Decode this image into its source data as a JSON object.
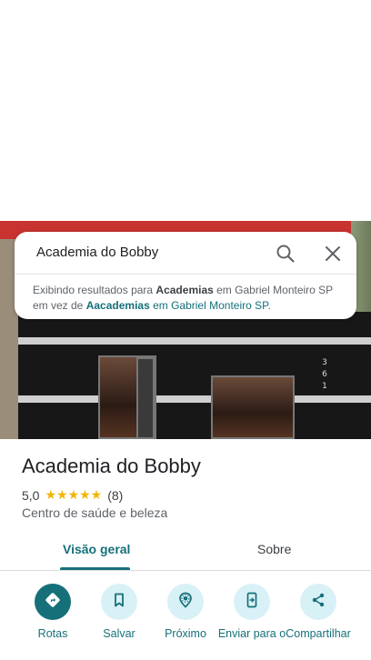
{
  "search": {
    "query": "Academia do Bobby",
    "notice_prefix": "Exibindo resultados para ",
    "notice_term": "Academias",
    "notice_middle": " em Gabriel Monteiro SP em vez de ",
    "notice_original_term": "Aacademias",
    "notice_original_rest": " em Gabriel Monteiro SP",
    "notice_suffix": "."
  },
  "photo": {
    "address_digits": "3\n6\n1"
  },
  "place": {
    "title": "Academia do Bobby",
    "rating": "5,0",
    "stars": "★★★★★",
    "review_count": "(8)",
    "category": "Centro de saúde e beleza"
  },
  "tabs": [
    {
      "label": "Visão geral",
      "selected": true
    },
    {
      "label": "Sobre",
      "selected": false
    }
  ],
  "actions": [
    {
      "label": "Rotas",
      "icon": "directions-icon"
    },
    {
      "label": "Salvar",
      "icon": "bookmark-icon"
    },
    {
      "label": "Próximo",
      "icon": "nearby-icon"
    },
    {
      "label": "Enviar para o",
      "icon": "send-to-phone-icon"
    },
    {
      "label": "Compartilhar",
      "icon": "share-icon"
    }
  ],
  "colors": {
    "accent": "#16707a",
    "action_bg": "#d8f1f6",
    "star": "#f4b400"
  }
}
